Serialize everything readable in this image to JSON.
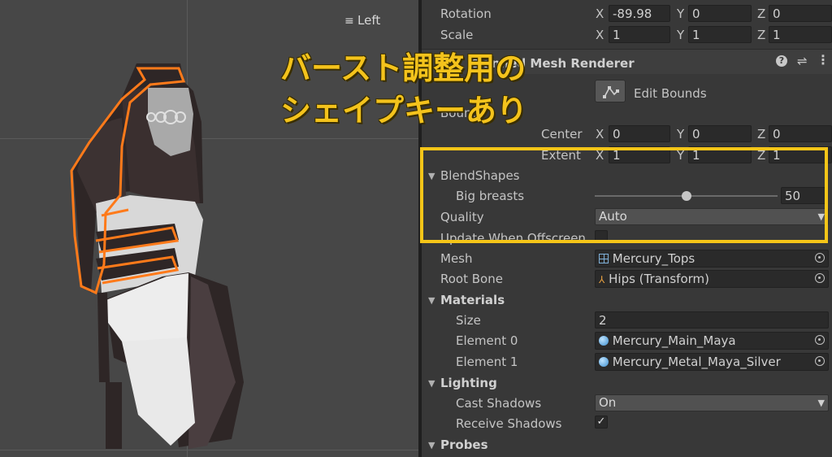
{
  "scene": {
    "view_label": "Left"
  },
  "overlay": {
    "line1": "バースト調整用の",
    "line2": "シェイプキーあり",
    "color": "#f4c31c"
  },
  "transform": {
    "rotation_label": "Rotation",
    "rotation": {
      "x": "-89.98",
      "y": "0",
      "z": "0"
    },
    "scale_label": "Scale",
    "scale": {
      "x": "1",
      "y": "1",
      "z": "1"
    }
  },
  "component": {
    "title": "Skinned Mesh Renderer",
    "edit_bounds_label": "Edit Bounds",
    "bounds_label": "Bounds",
    "center_label": "Center",
    "center": {
      "x": "0",
      "y": "0",
      "z": "0"
    },
    "extent_label": "Extent",
    "extent": {
      "x": "1",
      "y": "1",
      "z": "1"
    }
  },
  "axes": {
    "x": "X",
    "y": "Y",
    "z": "Z"
  },
  "blendshapes": {
    "label": "BlendShapes",
    "items": [
      {
        "name": "Big breasts",
        "value": "50",
        "fraction": 0.5
      }
    ]
  },
  "quality": {
    "label": "Quality",
    "value": "Auto"
  },
  "update_offscreen": {
    "label": "Update When Offscreen",
    "checked": false
  },
  "mesh": {
    "label": "Mesh",
    "value": "Mercury_Tops"
  },
  "root_bone": {
    "label": "Root Bone",
    "value": "Hips (Transform)"
  },
  "materials": {
    "label": "Materials",
    "size_label": "Size",
    "size": "2",
    "elements": [
      {
        "label": "Element 0",
        "value": "Mercury_Main_Maya"
      },
      {
        "label": "Element 1",
        "value": "Mercury_Metal_Maya_Silver"
      }
    ]
  },
  "lighting": {
    "label": "Lighting",
    "cast_shadows_label": "Cast Shadows",
    "cast_shadows": "On",
    "receive_shadows_label": "Receive Shadows",
    "receive_shadows": true
  },
  "probes": {
    "label": "Probes"
  },
  "highlight_color": "#f5c518"
}
